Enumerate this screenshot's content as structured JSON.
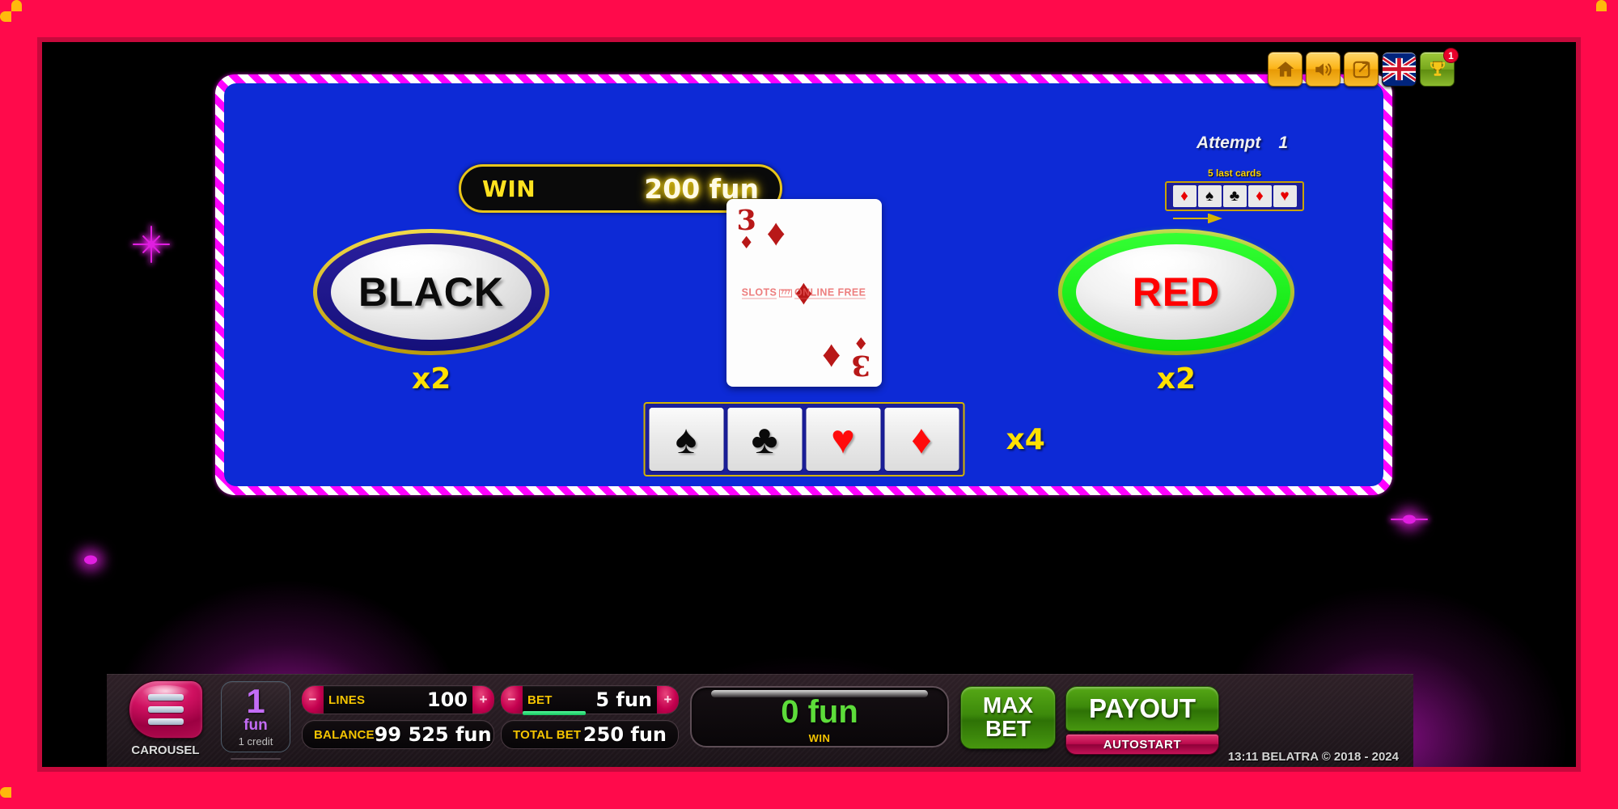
{
  "hud": {
    "buttons": [
      {
        "name": "home-icon",
        "label": "Home"
      },
      {
        "name": "sound-icon",
        "label": "Sound"
      },
      {
        "name": "fullscreen-icon",
        "label": "Open in new window"
      },
      {
        "name": "language-flag-icon",
        "label": "English"
      },
      {
        "name": "trophy-icon",
        "label": "Tournaments"
      }
    ],
    "trophy_badge": "1"
  },
  "gamble": {
    "win_label": "WIN",
    "win_amount": "200 fun",
    "attempt_label": "Attempt",
    "attempt_value": "1",
    "history_title": "5 last cards",
    "history_cards": [
      {
        "suit": "♦",
        "color": "red",
        "name": "diamond"
      },
      {
        "suit": "♠",
        "color": "black",
        "name": "spade"
      },
      {
        "suit": "♣",
        "color": "black",
        "name": "club"
      },
      {
        "suit": "♦",
        "color": "red",
        "name": "diamond"
      },
      {
        "suit": "♥",
        "color": "red",
        "name": "heart"
      }
    ],
    "black_button": "BLACK",
    "black_multiplier": "x2",
    "red_button": "RED",
    "red_multiplier": "x2",
    "suit_multiplier": "x4",
    "suit_buttons": [
      {
        "suit": "♠",
        "color": "black",
        "name": "spade"
      },
      {
        "suit": "♣",
        "color": "black",
        "name": "club"
      },
      {
        "suit": "♥",
        "color": "red",
        "name": "heart"
      },
      {
        "suit": "♦",
        "color": "red",
        "name": "diamond"
      }
    ],
    "card": {
      "rank": "3",
      "suit": "♦",
      "suit_name": "diamonds",
      "color": "red"
    },
    "watermark": {
      "left": "SLOTS",
      "box": "777",
      "right": "ONLINE FREE"
    }
  },
  "controls": {
    "menu_label": "CAROUSEL",
    "credit_value": "1",
    "credit_currency": "fun",
    "credit_sub": "1 credit",
    "lines_label": "LINES",
    "lines_value": "100",
    "balance_label": "BALANCE",
    "balance_value": "99 525 fun",
    "bet_label": "BET",
    "bet_value": "5 fun",
    "total_bet_label": "TOTAL BET",
    "total_bet_value": "250 fun",
    "win_display_amount": "0 fun",
    "win_display_label": "WIN",
    "max_bet_line1": "MAX",
    "max_bet_line2": "BET",
    "payout_label": "PAYOUT",
    "autostart_label": "AUTOSTART",
    "minus_symbol": "−",
    "plus_symbol": "+",
    "footer": "13:11  BELATRA © 2018 - 2024"
  },
  "colors": {
    "frame_pink": "#ff0a4b",
    "frame_dash": "#ffb80c",
    "gamble_blue": "#0d2ad6",
    "stripe_magenta": "#ff00ff",
    "gold": "#ffe000",
    "red_accent": "#ff0000",
    "green_ring": "#34ff34",
    "win_green": "#5ddc3a",
    "credit_purple": "#c36cf5"
  }
}
